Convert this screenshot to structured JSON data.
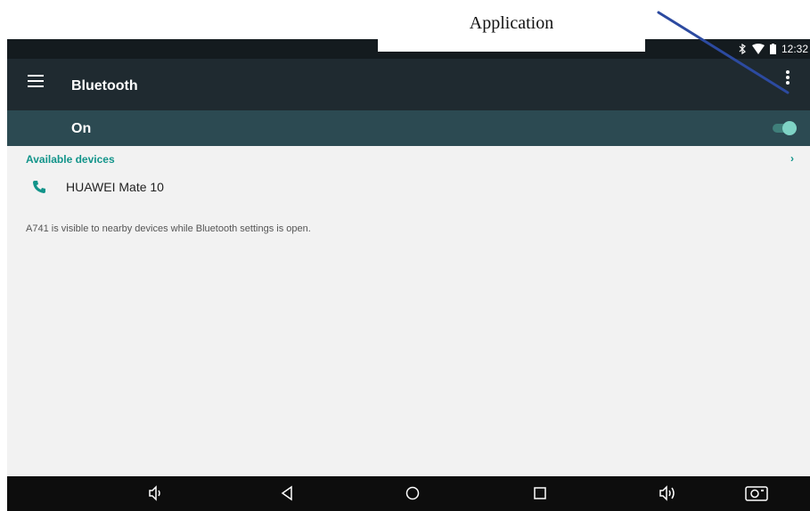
{
  "annotation": {
    "label": "Application"
  },
  "status_bar": {
    "time": "12:32",
    "icons": [
      "bluetooth-icon",
      "wifi-icon",
      "battery-icon"
    ]
  },
  "app_bar": {
    "title": "Bluetooth",
    "menu_icon": "hamburger-menu-icon",
    "overflow_icon": "more-vert-icon"
  },
  "toggle": {
    "label": "On",
    "state": "on",
    "accent": "#7fd3c5"
  },
  "devices": {
    "section_title": "Available devices",
    "items": [
      {
        "name": "HUAWEI Mate 10",
        "icon": "phone-icon"
      }
    ]
  },
  "visibility_note": "A741 is visible to nearby devices while Bluetooth settings is open.",
  "nav_bar": {
    "buttons": [
      "volume-down-icon",
      "back-icon",
      "home-icon",
      "recents-icon",
      "volume-up-icon",
      "screenshot-icon"
    ]
  },
  "colors": {
    "app_bar": "#1f2a30",
    "toggle_bar": "#2c4a52",
    "accent": "#12948a",
    "nav_bar": "#0d0d0d"
  }
}
